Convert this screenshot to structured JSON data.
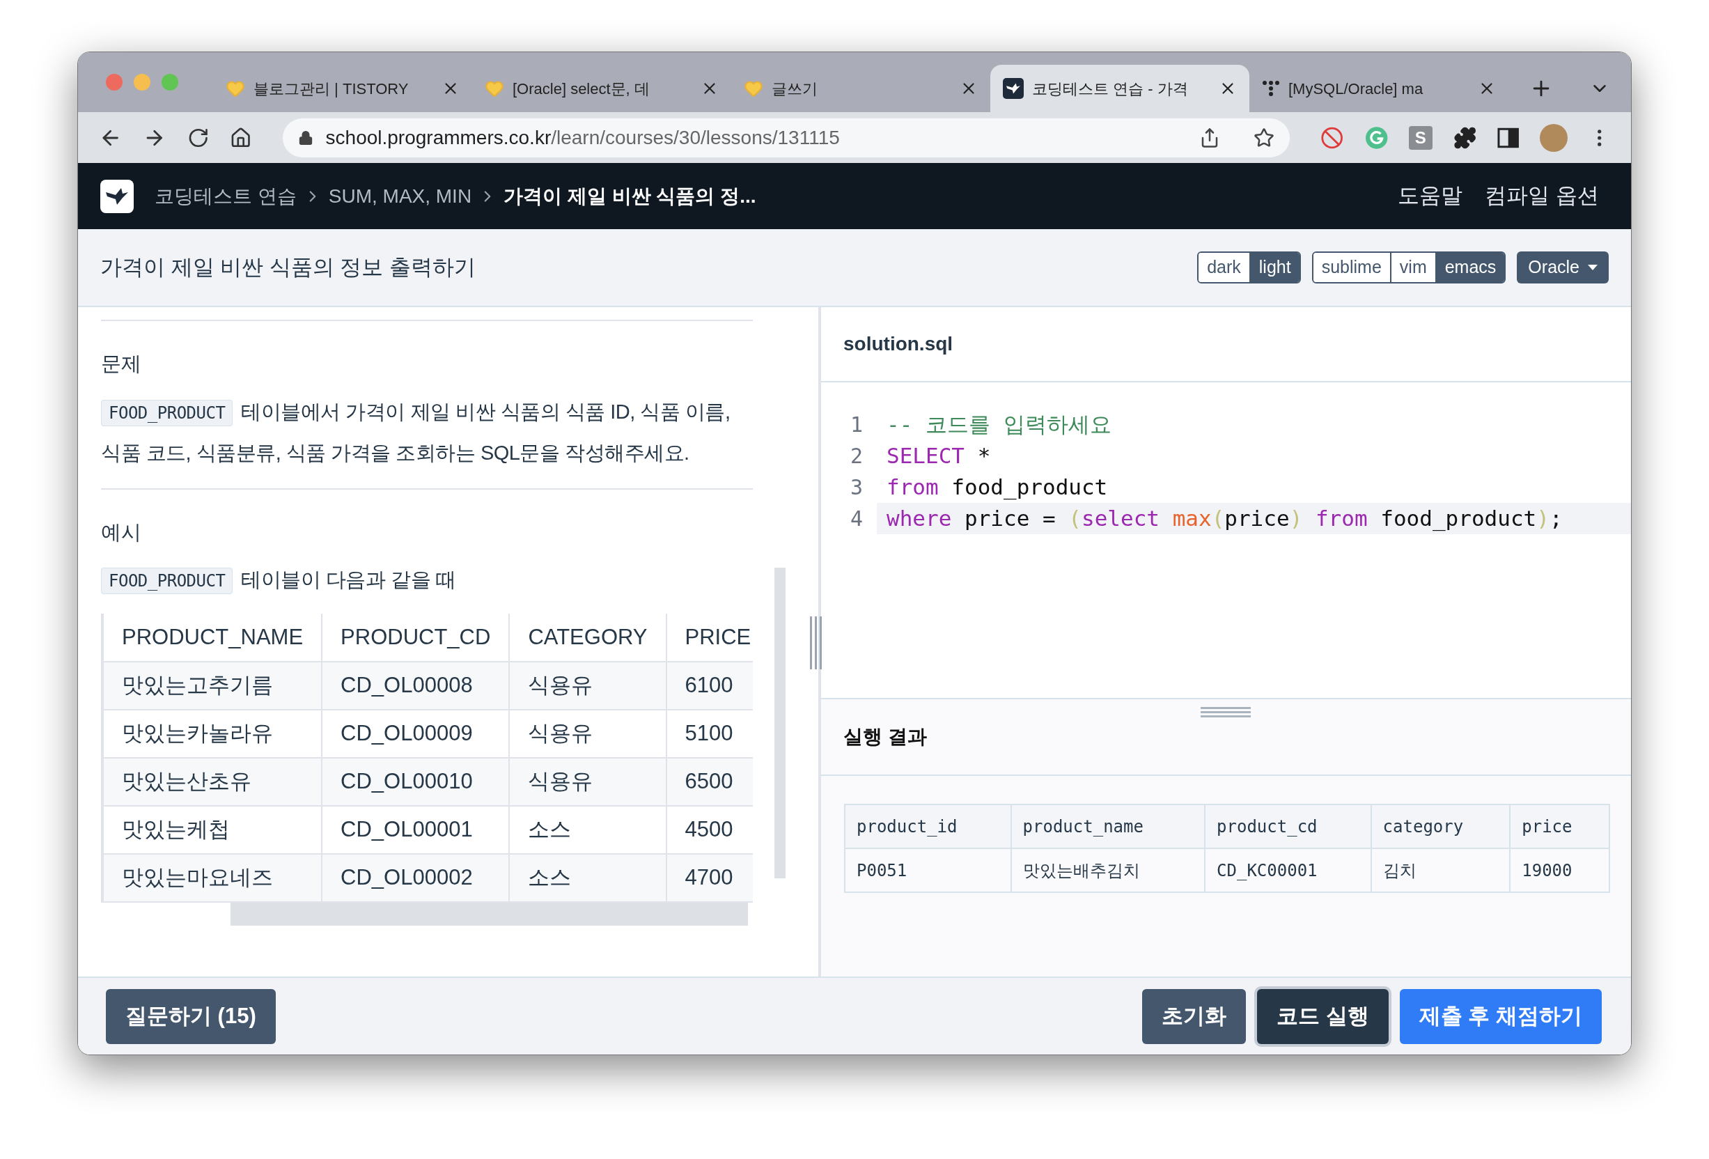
{
  "browser": {
    "tabs": [
      {
        "title": "블로그관리 | TISTORY",
        "kind": "heart",
        "selected": false
      },
      {
        "title": "[Oracle] select문, 데",
        "kind": "heart",
        "selected": false
      },
      {
        "title": "글쓰기",
        "kind": "heart",
        "selected": false
      },
      {
        "title": "코딩테스트 연습 - 가격",
        "kind": "bird",
        "selected": true
      },
      {
        "title": "[MySQL/Oracle] ma",
        "kind": "dots",
        "selected": false
      }
    ],
    "url": {
      "host": "school.programmers.co.kr",
      "path": "/learn/courses/30/lessons/131115"
    },
    "extension_label": "S"
  },
  "nav": {
    "breadcrumbs": [
      {
        "label": "코딩테스트 연습",
        "current": false
      },
      {
        "label": "SUM, MAX, MIN",
        "current": false
      },
      {
        "label": "가격이 제일 비싼 식품의 정...",
        "current": true
      }
    ],
    "links": [
      "도움말",
      "컴파일 옵션"
    ]
  },
  "toolbar": {
    "title": "가격이 제일 비싼 식품의 정보 출력하기",
    "themes": [
      {
        "label": "dark",
        "selected": false
      },
      {
        "label": "light",
        "selected": true
      }
    ],
    "keymaps": [
      {
        "label": "sublime",
        "selected": false
      },
      {
        "label": "vim",
        "selected": false
      },
      {
        "label": "emacs",
        "selected": true
      }
    ],
    "language": "Oracle"
  },
  "problem": {
    "sections": [
      {
        "heading": "문제",
        "chip": "FOOD_PRODUCT",
        "text": "테이블에서 가격이 제일 비싼 식품의 식품 ID, 식품 이름, 식품 코드, 식품분류, 식품 가격을 조회하는 SQL문을 작성해주세요."
      },
      {
        "heading": "예시",
        "chip": "FOOD_PRODUCT",
        "text": "테이블이 다음과 같을 때"
      }
    ],
    "table": {
      "columns": [
        "PRODUCT_NAME",
        "PRODUCT_CD",
        "CATEGORY",
        "PRICE"
      ],
      "rows": [
        [
          "맛있는고추기름",
          "CD_OL00008",
          "식용유",
          "6100"
        ],
        [
          "맛있는카놀라유",
          "CD_OL00009",
          "식용유",
          "5100"
        ],
        [
          "맛있는산초유",
          "CD_OL00010",
          "식용유",
          "6500"
        ],
        [
          "맛있는케첩",
          "CD_OL00001",
          "소스",
          "4500"
        ],
        [
          "맛있는마요네즈",
          "CD_OL00002",
          "소스",
          "4700"
        ]
      ]
    }
  },
  "editor": {
    "filename": "solution.sql",
    "lines": [
      {
        "number": "1",
        "active": false,
        "tokens": [
          {
            "kind": "comment",
            "text": "-- 코드를 입력하세요"
          }
        ]
      },
      {
        "number": "2",
        "active": false,
        "tokens": [
          {
            "kind": "keyword",
            "text": "SELECT"
          },
          {
            "kind": "plain",
            "text": " *"
          }
        ]
      },
      {
        "number": "3",
        "active": false,
        "tokens": [
          {
            "kind": "keyword",
            "text": "from"
          },
          {
            "kind": "plain",
            "text": " food_product"
          }
        ]
      },
      {
        "number": "4",
        "active": true,
        "tokens": [
          {
            "kind": "keyword",
            "text": "where"
          },
          {
            "kind": "plain",
            "text": " price = "
          },
          {
            "kind": "paren",
            "text": "("
          },
          {
            "kind": "keyword",
            "text": "select"
          },
          {
            "kind": "function",
            "text": " max"
          },
          {
            "kind": "paren",
            "text": "("
          },
          {
            "kind": "plain",
            "text": "price"
          },
          {
            "kind": "paren",
            "text": ")"
          },
          {
            "kind": "keyword",
            "text": " from"
          },
          {
            "kind": "plain",
            "text": " food_product"
          },
          {
            "kind": "paren",
            "text": ")"
          },
          {
            "kind": "plain",
            "text": ";"
          }
        ]
      }
    ]
  },
  "results": {
    "title": "실행 결과",
    "columns": [
      "product_id",
      "product_name",
      "product_cd",
      "category",
      "price"
    ],
    "rows": [
      [
        "P0051",
        "맛있는배추김치",
        "CD_KC00001",
        "김치",
        "19000"
      ]
    ]
  },
  "footer": {
    "left": [
      {
        "label": "질문하기 (15)",
        "kind": "secondary"
      }
    ],
    "right": [
      {
        "label": "초기화",
        "kind": "secondary"
      },
      {
        "label": "코드 실행",
        "kind": "focused"
      },
      {
        "label": "제출 후 채점하기",
        "kind": "primary"
      }
    ]
  }
}
